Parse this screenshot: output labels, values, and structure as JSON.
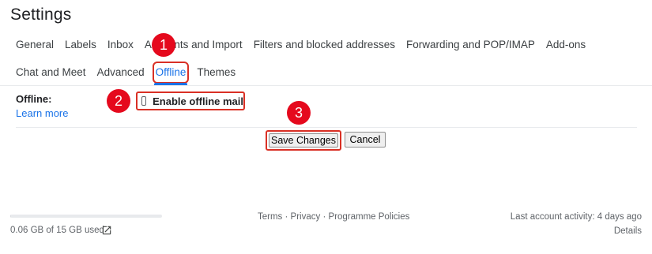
{
  "page_title": "Settings",
  "tabs_row1": [
    "General",
    "Labels",
    "Inbox",
    "Accounts and Import",
    "Filters and blocked addresses",
    "Forwarding and POP/IMAP",
    "Add-ons"
  ],
  "tabs_row2": [
    "Chat and Meet",
    "Advanced",
    "Offline",
    "Themes"
  ],
  "active_tab": "Offline",
  "offline_section": {
    "label": "Offline:",
    "learn_more": "Learn more",
    "enable_label": "Enable offline mail",
    "enable_checked": false
  },
  "buttons": {
    "save": "Save Changes",
    "cancel": "Cancel"
  },
  "annotations": {
    "step1": "1",
    "step2": "2",
    "step3": "3",
    "color": "#e5091d"
  },
  "footer": {
    "storage_used_text": "0.06 GB of 15 GB used",
    "storage_fraction": 0.004,
    "links": [
      "Terms",
      "Privacy",
      "Programme Policies"
    ],
    "separator": " · ",
    "last_activity": "Last account activity: 4 days ago",
    "details": "Details"
  },
  "colors": {
    "accent": "#1a73e8",
    "highlight_border": "#d93025"
  },
  "icons": {
    "external_link": "open-in-new-icon"
  }
}
